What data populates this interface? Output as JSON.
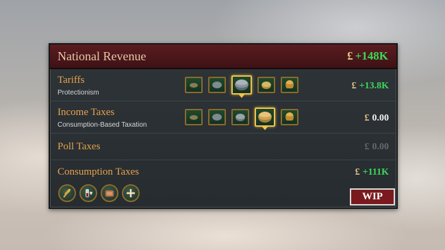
{
  "panel": {
    "title": "National Revenue",
    "currency_symbol": "£",
    "total": "+148K"
  },
  "rows": [
    {
      "title": "Tariffs",
      "subtitle": "Protectionism",
      "value": "+13.8K",
      "value_color": "#3cd85a",
      "selected_level": 3
    },
    {
      "title": "Income Taxes",
      "subtitle": "Consumption-Based Taxation",
      "value": "0.00",
      "value_color": "#f0f0f0",
      "selected_level": 4
    },
    {
      "title": "Poll Taxes",
      "subtitle": "",
      "value": "0.00",
      "value_color": "#626a6e"
    },
    {
      "title": "Consumption Taxes",
      "subtitle": "",
      "value": "+111K",
      "value_color": "#3cd85a"
    }
  ],
  "bottom_icons": [
    "wheat-icon",
    "wine-icon",
    "meat-icon",
    "add-icon"
  ],
  "wip_badge": "WIP"
}
